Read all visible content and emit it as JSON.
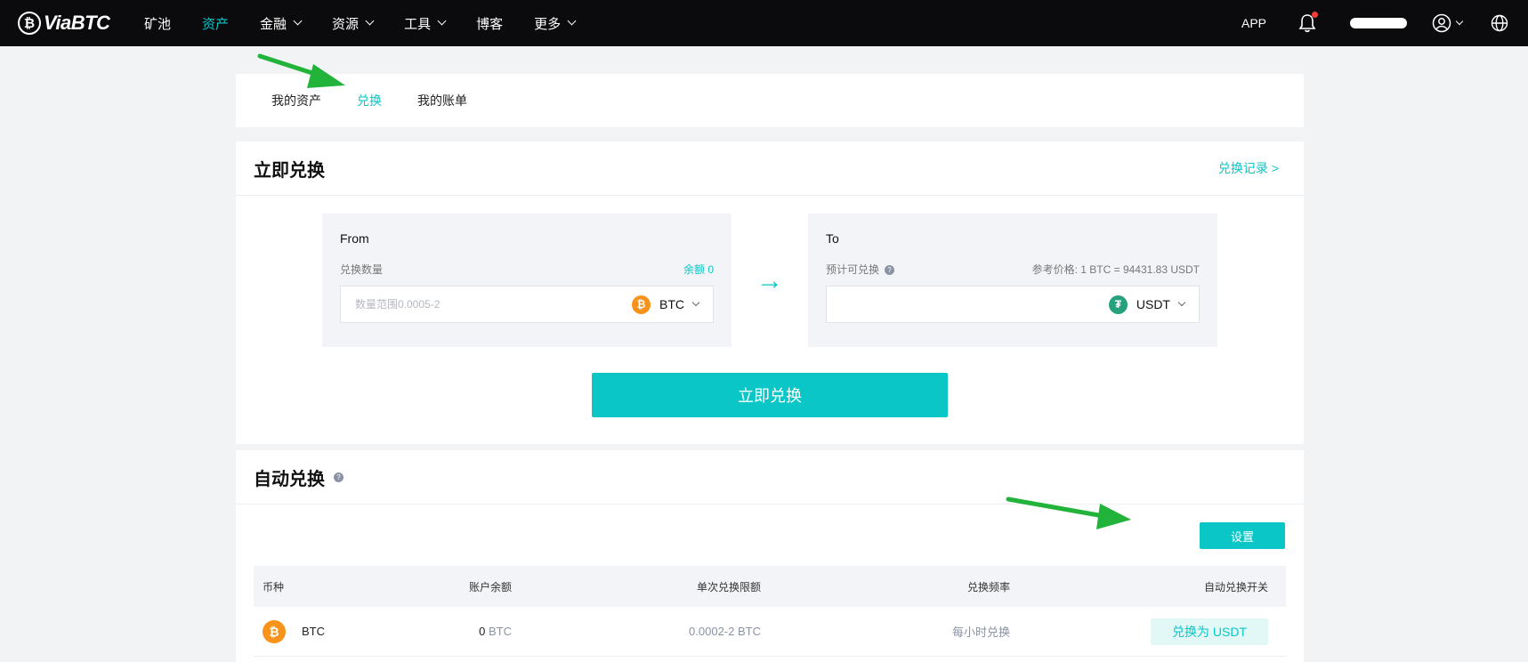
{
  "header": {
    "brand": "ViaBTC",
    "nav": [
      {
        "label": "矿池",
        "dropdown": false,
        "active": false
      },
      {
        "label": "资产",
        "dropdown": false,
        "active": true
      },
      {
        "label": "金融",
        "dropdown": true,
        "active": false
      },
      {
        "label": "资源",
        "dropdown": true,
        "active": false
      },
      {
        "label": "工具",
        "dropdown": true,
        "active": false
      },
      {
        "label": "博客",
        "dropdown": false,
        "active": false
      },
      {
        "label": "更多",
        "dropdown": true,
        "active": false
      }
    ],
    "app_label": "APP",
    "has_notification": true
  },
  "tabs": [
    {
      "label": "我的资产",
      "active": false
    },
    {
      "label": "兑换",
      "active": true
    },
    {
      "label": "我的账单",
      "active": false
    }
  ],
  "exchange": {
    "title": "立即兑换",
    "record_link": "兑换记录 >",
    "from": {
      "label": "From",
      "amount_label": "兑换数量",
      "balance": "余额 0",
      "placeholder": "数量范围0.0005-2",
      "coin": "BTC"
    },
    "to": {
      "label": "To",
      "estimate_label": "预计可兑换",
      "reference_price": "参考价格:   1 BTC = 94431.83 USDT",
      "coin": "USDT"
    },
    "arrow": "→",
    "submit_label": "立即兑换"
  },
  "auto_exchange": {
    "title": "自动兑换",
    "settings_label": "设置",
    "columns": [
      "币种",
      "账户余额",
      "单次兑换限额",
      "兑换频率",
      "自动兑换开关"
    ],
    "rows": [
      {
        "coin": "BTC",
        "balance_value": "0",
        "balance_unit": "BTC",
        "limit_value": "0.0002-2",
        "limit_unit": "BTC",
        "frequency": "每小时兑换",
        "action": "兑换为 USDT"
      }
    ]
  },
  "colors": {
    "accent": "#0bc6c6",
    "topbar": "#0b0b0d",
    "annotation_arrow": "#22b33a",
    "btc": "#f7931a",
    "usdt": "#26a17b"
  }
}
